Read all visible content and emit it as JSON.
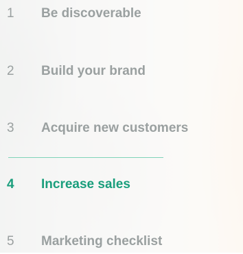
{
  "nav": {
    "accent_color": "#1a9e7c",
    "inactive_color": "#9aa0a0",
    "items": [
      {
        "number": "1",
        "label": "Be discoverable"
      },
      {
        "number": "2",
        "label": "Build your brand"
      },
      {
        "number": "3",
        "label": "Acquire new customers"
      },
      {
        "number": "4",
        "label": "Increase sales",
        "active": true
      },
      {
        "number": "5",
        "label": "Marketing checklist"
      }
    ]
  }
}
